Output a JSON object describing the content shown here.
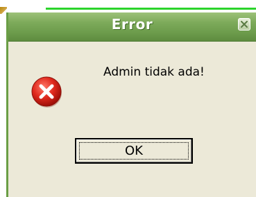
{
  "dialog": {
    "title": "Error",
    "message": "Admin tidak ada!",
    "ok_label": "OK",
    "icon": "error-icon",
    "close_icon": "close-icon"
  },
  "colors": {
    "titlebar": "#7daa5a",
    "window_bg": "#ece9d8",
    "error_red": "#e02020",
    "background_line": "#2bd42b"
  }
}
